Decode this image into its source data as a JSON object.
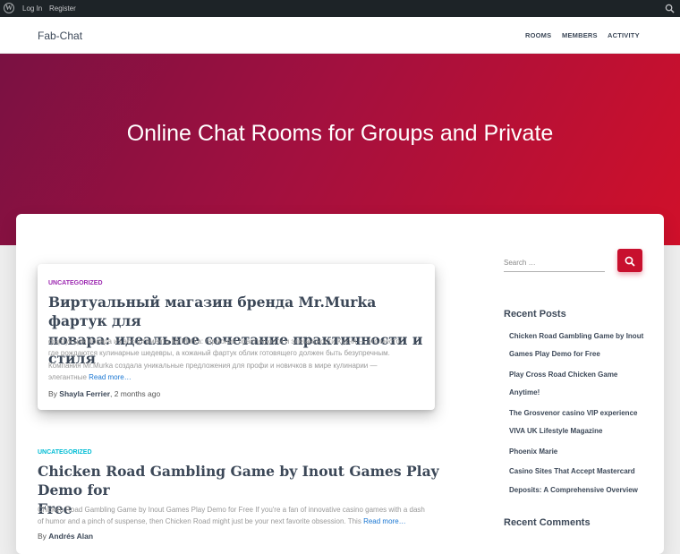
{
  "adminbar": {
    "login": "Log In",
    "register": "Register"
  },
  "site": {
    "brand": "Fab-Chat"
  },
  "nav": {
    "items": [
      "ROOMS",
      "MEMBERS",
      "ACTIVITY"
    ]
  },
  "hero": {
    "title": "Online Chat Rooms for Groups and Private"
  },
  "posts": [
    {
      "category": "UNCATEGORIZED",
      "title_line1": "Виртуальный магазин бренда Mr.Murka фартук для",
      "title_line2": "повара: идеальное сочетание практичности и стиля",
      "excerpt_line1": "фартук для повара из ассортимента Mr.Murka: гармония практичности и элегантности Кухня — это место,",
      "excerpt_line2": "где рождаются кулинарные шедевры, а кожаный фартук облик готовящего должен быть безупречным.",
      "excerpt_line3": "Компания Mr.Murka создала уникальные предложения для профи и новичков в мире кулинарии —",
      "excerpt_line4": "элегантные",
      "read_more": "Read more…",
      "by": "By",
      "author": "Shayla Ferrier",
      "time": ", 2 months ago"
    },
    {
      "category": "UNCATEGORIZED",
      "title_line1": "Chicken Road Gambling Game by Inout Games Play Demo for",
      "title_line2": "Free",
      "excerpt_line1": "Chicken Road Gambling Game by Inout Games Play Demo for Free If you're a fan of innovative casino games with a dash",
      "excerpt_line2": "of humor and a pinch of suspense, then Chicken Road might just be your next favorite obsession. This",
      "read_more": "Read more…",
      "by": "By",
      "author": "Andrés Alan"
    }
  ],
  "sidebar": {
    "search_placeholder": "Search …",
    "recent_posts_title": "Recent Posts",
    "recent_posts": [
      "Chicken Road Gambling Game by Inout",
      "Games Play Demo for Free",
      "Play Cross Road Chicken Game",
      "Anytime!",
      "The Grosvenor casino VIP experience",
      "VIVA UK Lifestyle Magazine",
      "Phoenix Marie",
      "Casino Sites That Accept Mastercard",
      "Deposits: A Comprehensive Overview"
    ],
    "recent_comments_title": "Recent Comments"
  },
  "colors": {
    "accent": "#c8102e",
    "category_pink": "#9c27b0",
    "category_cyan": "#00bcd4",
    "link": "#1976d2",
    "heading": "#3c4858"
  }
}
